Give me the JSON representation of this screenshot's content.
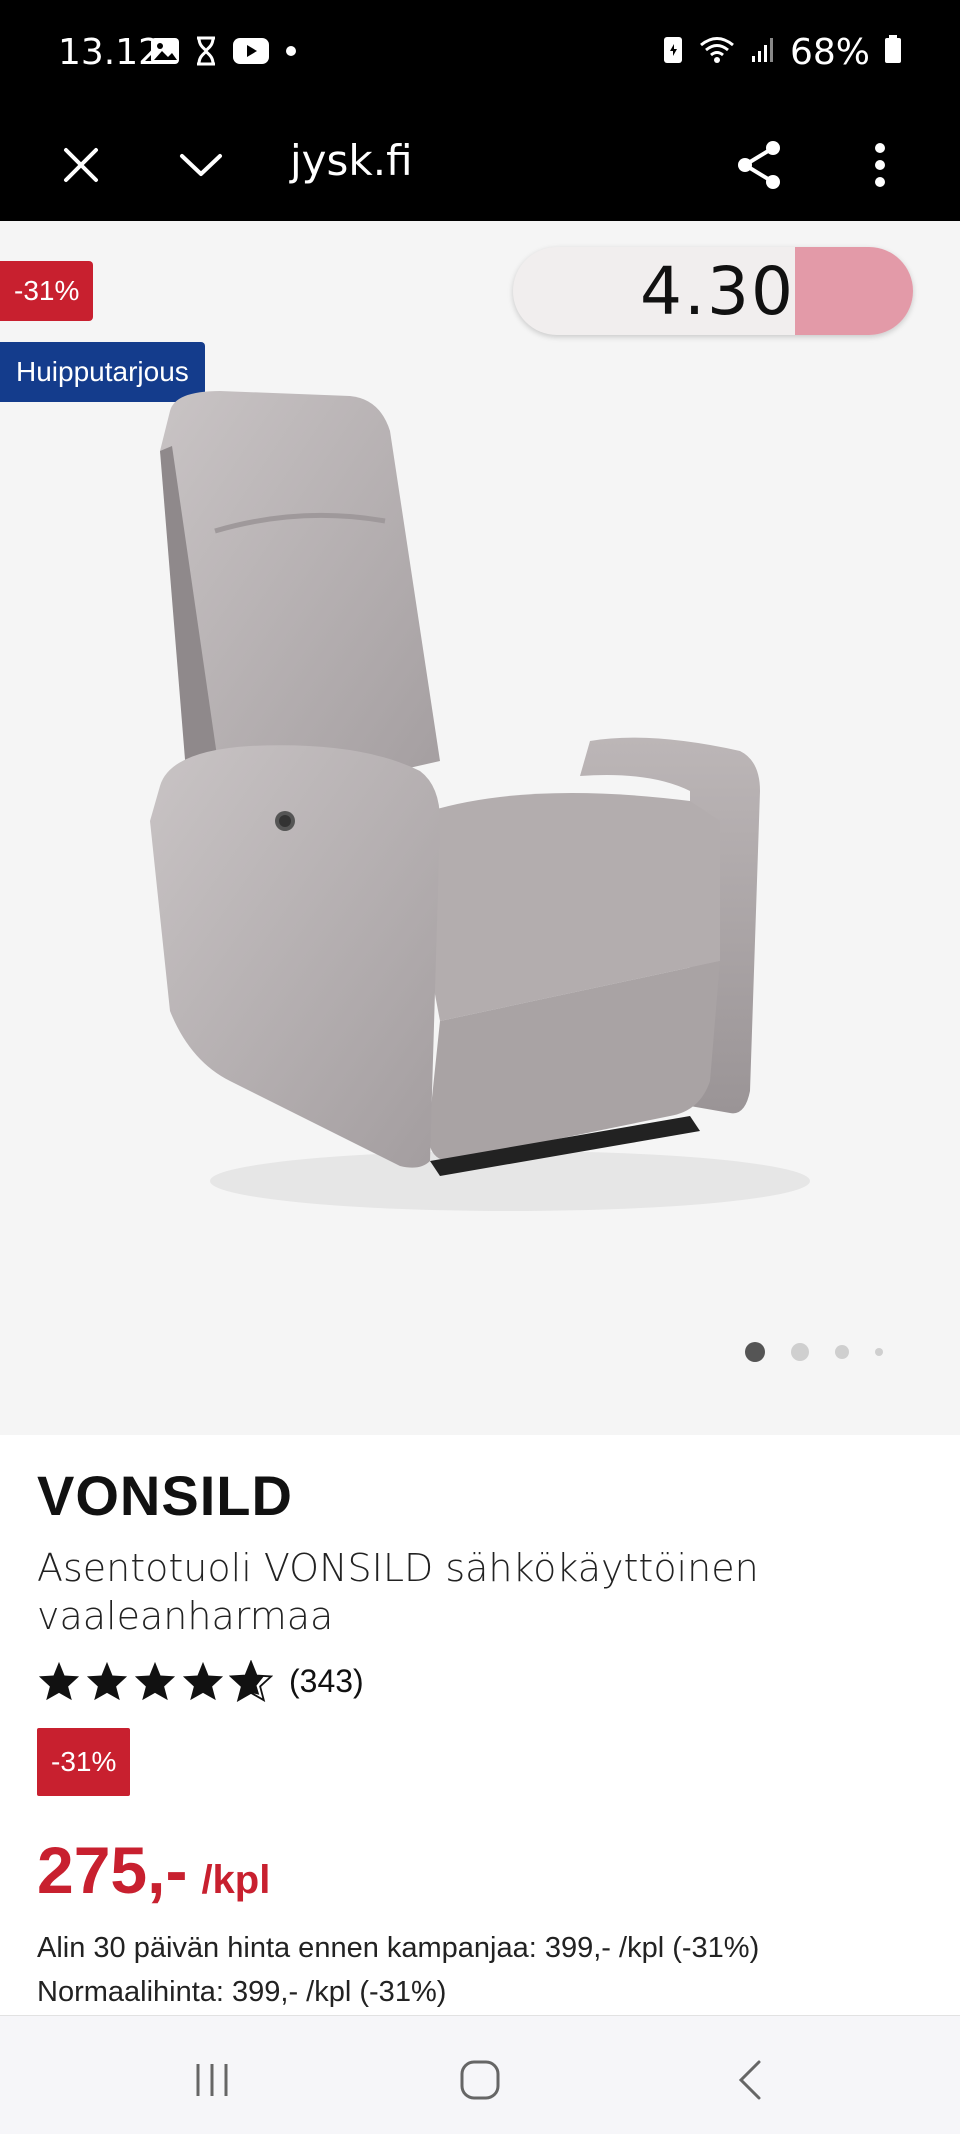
{
  "status_bar": {
    "time": "13.12",
    "battery": "68%",
    "icons": [
      "gallery-icon",
      "hourglass-icon",
      "youtube-icon",
      "dot-icon",
      "battery-saver-icon",
      "wifi-icon",
      "signal-icon",
      "battery-icon"
    ]
  },
  "browser": {
    "url": "jysk.fi",
    "icons": [
      "close-icon",
      "chevron-down-icon",
      "share-icon",
      "more-vert-icon"
    ]
  },
  "hero": {
    "discount_badge": "-31%",
    "offer_badge": "Huipputarjous",
    "speed_value": "4.30",
    "carousel_count": 4,
    "carousel_active": 0
  },
  "product": {
    "brand": "VONSILD",
    "description": "Asentotuoli VONSILD sähkökäyttöinen vaaleanharmaa",
    "rating": 4.5,
    "review_count": "(343)",
    "discount_badge": "-31%",
    "price": "275,-",
    "price_unit": "/kpl",
    "lowest_price_note": "Alin 30 päivän hinta ennen kampanjaa: 399,- /kpl (-31%)",
    "normal_price_note": "Normaalihinta: 399,- /kpl (-31%)"
  },
  "navigation": {
    "icons": [
      "recent-apps-icon",
      "home-icon",
      "back-icon"
    ]
  },
  "colors": {
    "accent_red": "#c8202f",
    "accent_blue": "#143c8c",
    "speed_fill": "#e39aa8"
  }
}
